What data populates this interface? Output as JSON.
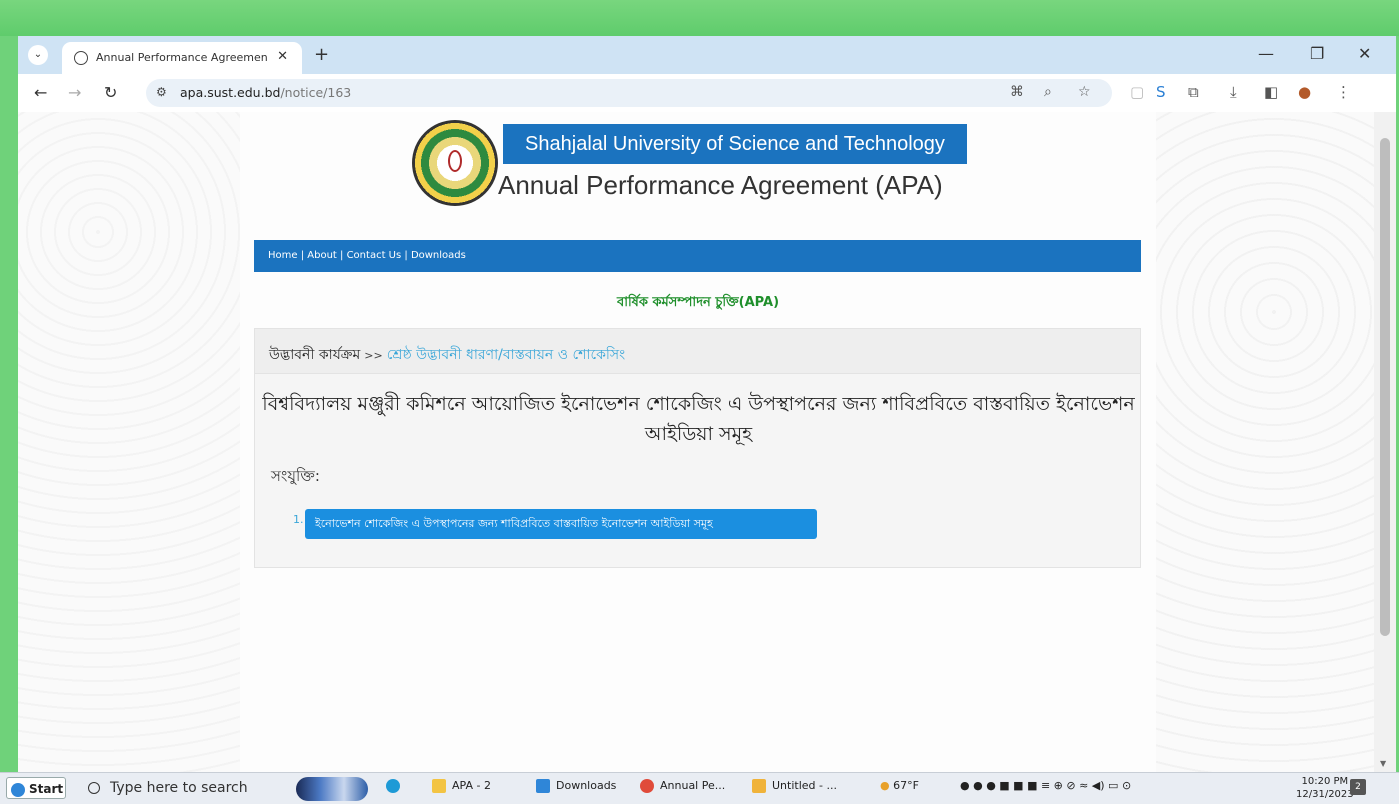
{
  "browser": {
    "tab_title": "Annual Performance Agreemen",
    "url_host": "apa.sust.edu.bd",
    "url_path": "/notice/163"
  },
  "site": {
    "university_name": "Shahjalal University of Science and Technology",
    "apa_title": "Annual Performance Agreement (APA)",
    "nav_links": [
      "Home",
      "About",
      "Contact Us",
      "Downloads"
    ],
    "subtitle": "বার্ষিক কর্মসম্পাদন চুক্তি(APA)",
    "breadcrumb_root": "উদ্ভাবনী কার্যক্রম",
    "breadcrumb_sep": ">>",
    "breadcrumb_link": "শ্রেষ্ঠ উদ্ভাবনী ধারণা/বাস্তবায়ন ও শোকেসিং",
    "notice_title": "বিশ্ববিদ্যালয় মঞ্জুরী কমিশনে আয়োজিত ইনোভেশন শোকেজিং এ উপস্থাপনের জন্য শাবিপ্রবিতে বাস্তবায়িত ইনোভেশন আইডিয়া সমূহ",
    "attachments_label": "সংযুক্তি:",
    "attachments": [
      {
        "number": "1.",
        "label": "ইনোভেশন শোকেজিং এ উপস্থাপনের জন্য শাবিপ্রবিতে বাস্তবায়িত ইনোভেশন আইডিয়া সমূহ"
      }
    ]
  },
  "taskbar": {
    "start_label": "Start",
    "search_placeholder": "Type here to search",
    "apps": [
      "APA - 2",
      "Downloads",
      "Annual Pe...",
      "Untitled - ..."
    ],
    "weather": "67°F",
    "time": "10:20 PM",
    "date": "12/31/2023",
    "notification_count": "2"
  },
  "colors": {
    "accent_blue": "#1b73bf",
    "subtitle_green": "#1f8f2b",
    "link_blue": "#3aa6d8"
  }
}
